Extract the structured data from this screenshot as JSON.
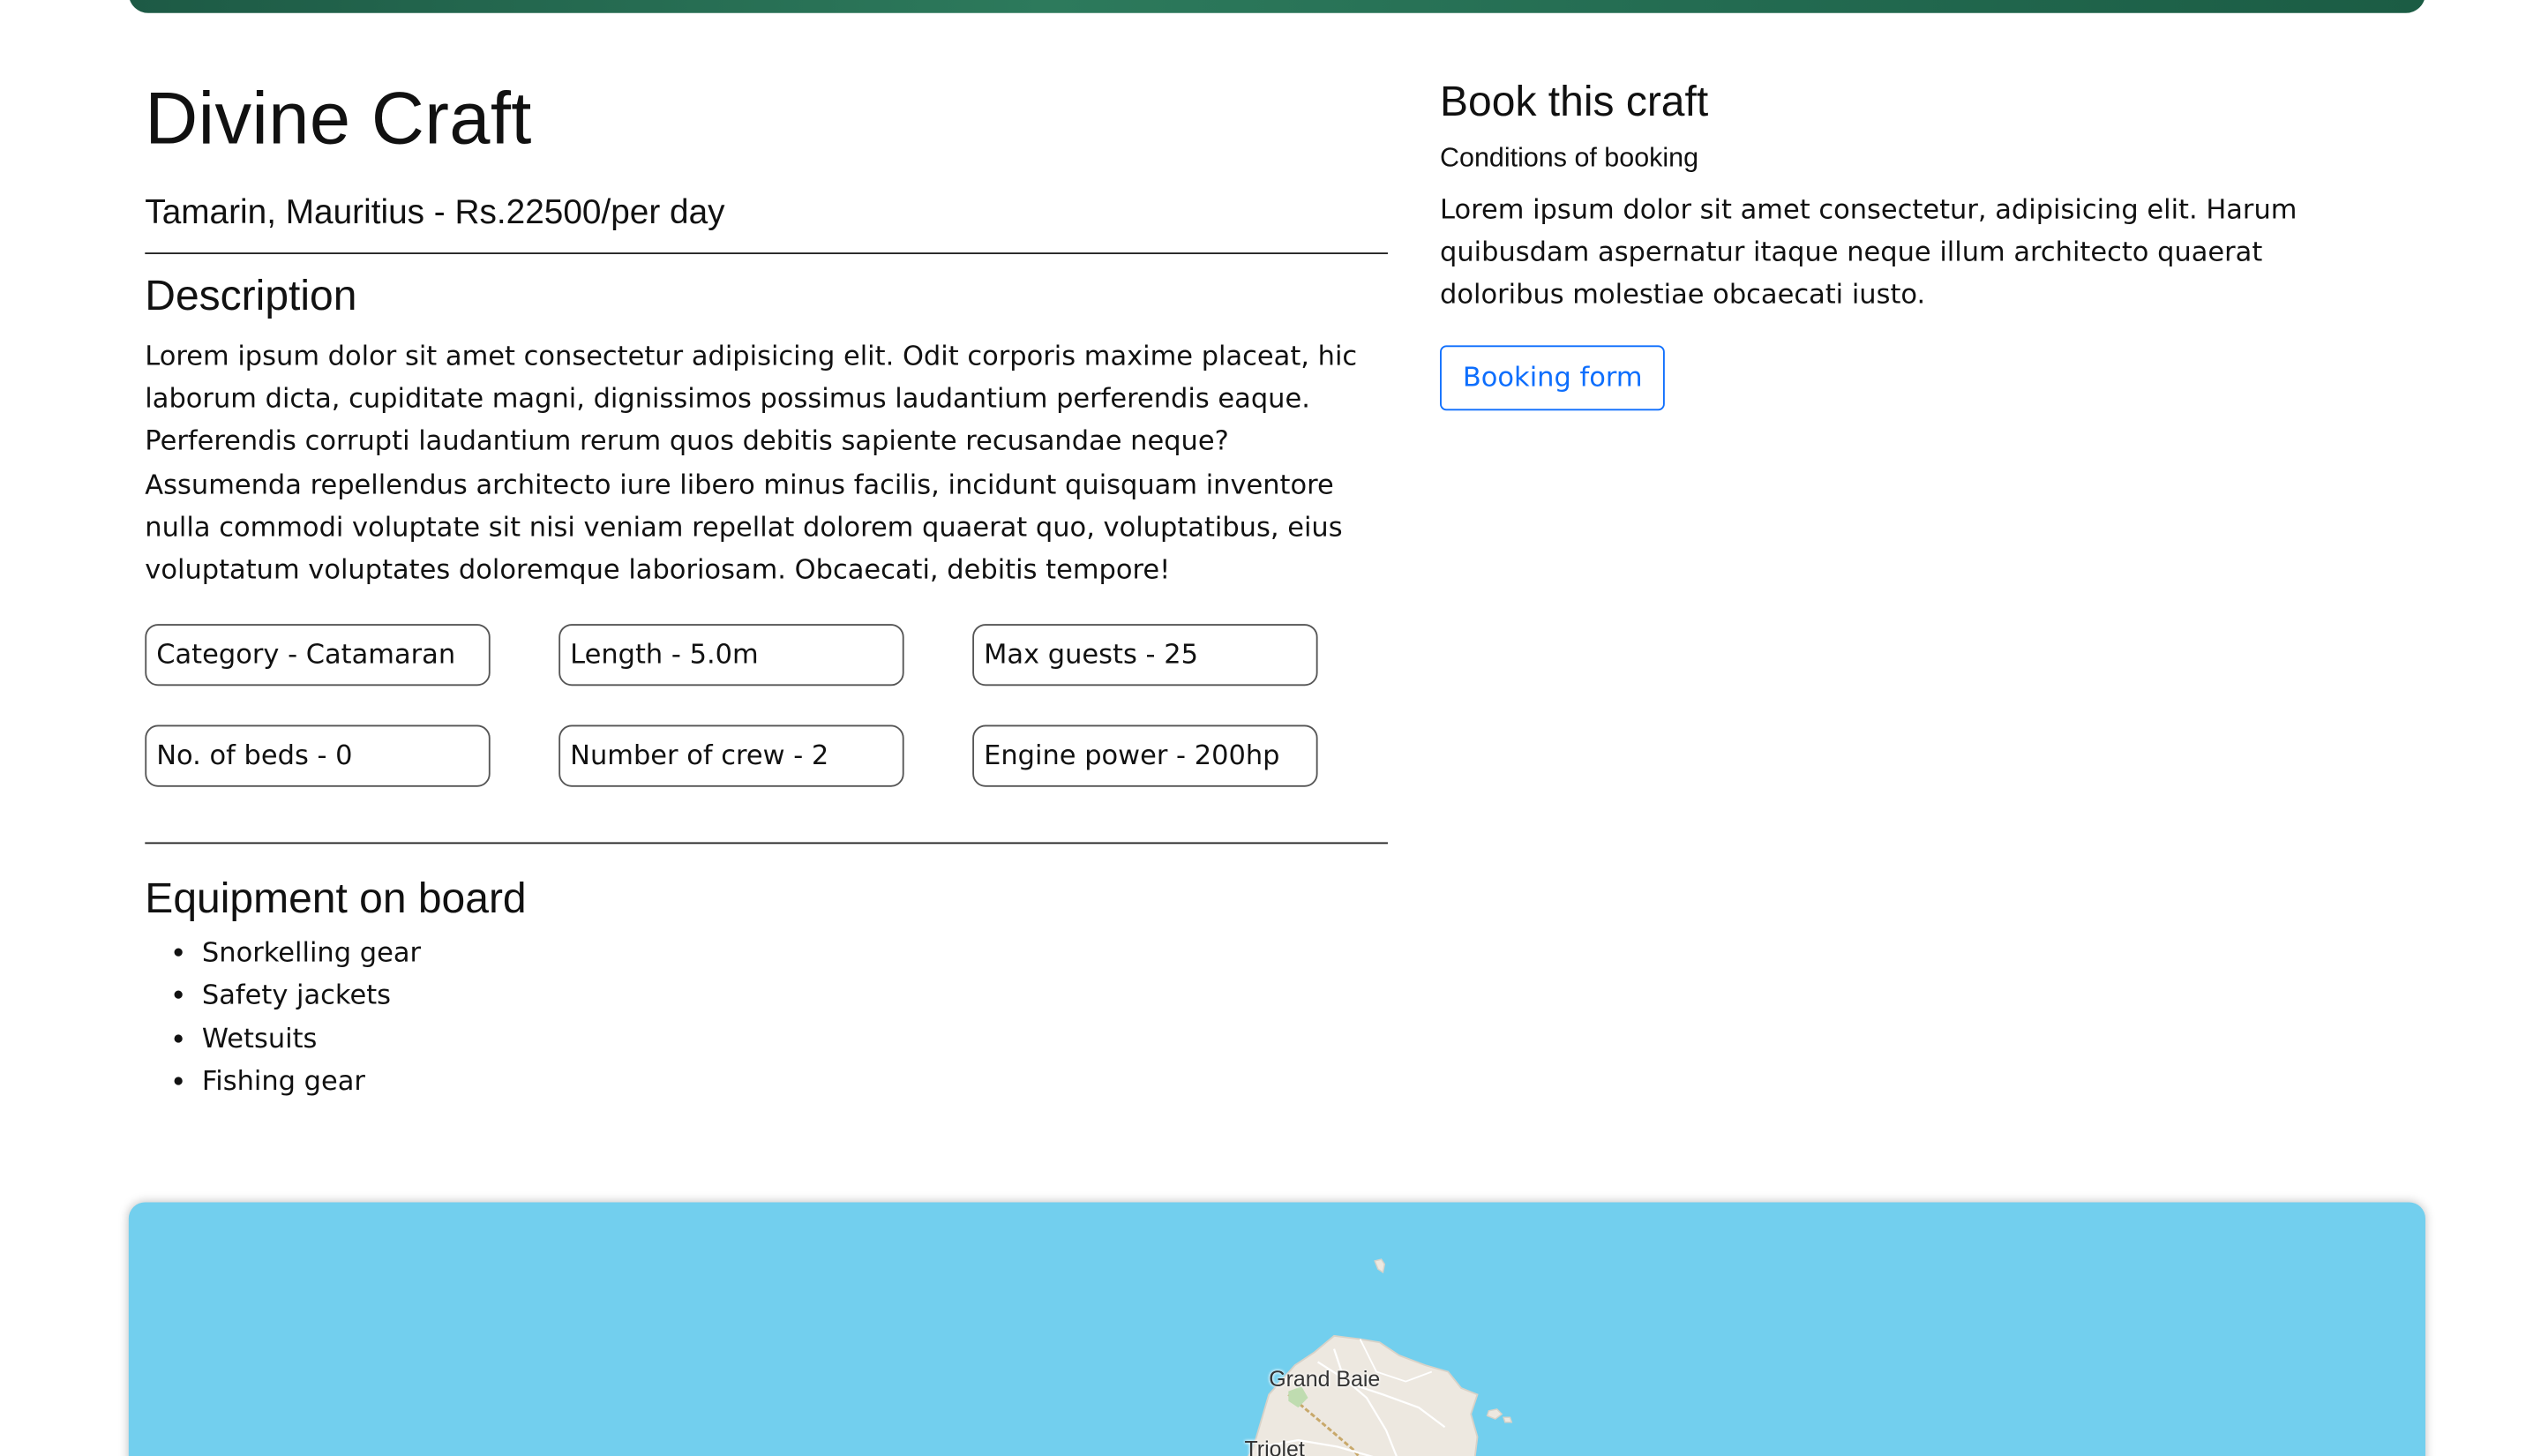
{
  "craft": {
    "title": "Divine Craft",
    "subtitle": "Tamarin, Mauritius - Rs.22500/per day"
  },
  "description": {
    "heading": "Description",
    "text": "Lorem ipsum dolor sit amet consectetur adipisicing elit. Odit corporis maxime placeat, hic laborum dicta, cupiditate magni, dignissimos possimus laudantium perferendis eaque. Perferendis corrupti laudantium rerum quos debitis sapiente recusandae neque? Assumenda repellendus architecto iure libero minus facilis, incidunt quisquam inventore nulla commodi voluptate sit nisi veniam repellat dolorem quaerat quo, voluptatibus, eius voluptatum voluptates doloremque laboriosam. Obcaecati, debitis tempore!"
  },
  "specs": [
    "Category - Catamaran",
    "Length - 5.0m",
    "Max guests - 25",
    "No. of beds - 0",
    "Number of crew - 2",
    "Engine power - 200hp"
  ],
  "equipment": {
    "heading": "Equipment on board",
    "items": [
      "Snorkelling gear",
      "Safety jackets",
      "Wetsuits",
      "Fishing gear"
    ]
  },
  "booking": {
    "title": "Book this craft",
    "conditions": "Conditions of booking",
    "text": "Lorem ipsum dolor sit amet consectetur, adipisicing elit. Harum quibusdam aspernatur itaque neque illum architecto quaerat doloribus molestiae obcaecati iusto.",
    "button_label": "Booking form"
  },
  "map": {
    "labels": [
      "Grand Baie",
      "Triolet"
    ],
    "colors": {
      "water": "#72cfee",
      "land": "#ede8e0",
      "primary": "#0d6efd"
    }
  }
}
